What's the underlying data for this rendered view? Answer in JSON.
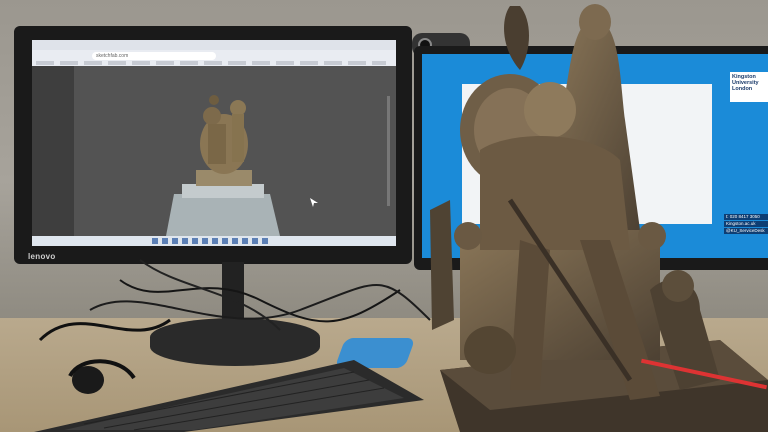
{
  "left_monitor": {
    "brand": "lenovo",
    "browser_address": "sketchfab.com"
  },
  "right_monitor": {
    "logo_line1": "Kingston",
    "logo_line2": "University",
    "logo_line3": "London",
    "contact_phone": "t: 020 8417 3050",
    "contact_web": "Kingston.ac.uk",
    "contact_handle": "@KU_ServiceDesk"
  },
  "colors": {
    "wall": "#9b978f",
    "desk": "#b9a98d",
    "bronze": "#6b5a45",
    "right_screen": "#1b8bd8"
  },
  "icons": [
    "webcam-icon",
    "keyboard-icon",
    "headphones-icon"
  ]
}
